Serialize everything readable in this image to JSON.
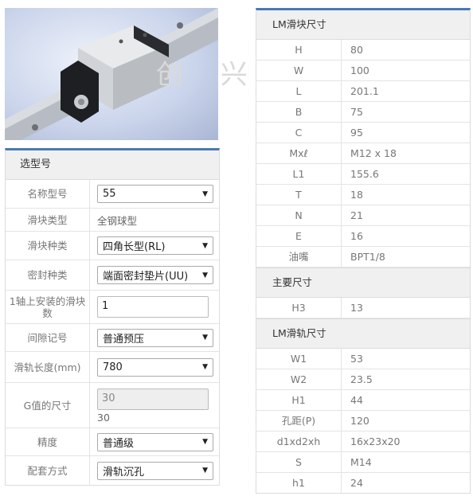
{
  "watermark": "创 兴 盛",
  "left_panel": {
    "title": "选型号",
    "rows": {
      "model_name": {
        "label": "名称型号",
        "value": "55"
      },
      "block_type": {
        "label": "滑块类型",
        "value": "全钢球型"
      },
      "block_kind": {
        "label": "滑块种类",
        "value": "四角长型(RL)"
      },
      "seal_kind": {
        "label": "密封种类",
        "value": "端面密封垫片(UU)"
      },
      "blocks_per_axis": {
        "label": "1轴上安装的滑块数",
        "value": "1"
      },
      "clearance": {
        "label": "间隙记号",
        "value": "普通预压"
      },
      "rail_length": {
        "label": "滑轨长度(mm)",
        "value": "780"
      },
      "g_value": {
        "label": "G值的尺寸",
        "input_value": "30",
        "text_value": "30"
      },
      "precision": {
        "label": "精度",
        "value": "普通级"
      },
      "fit_method": {
        "label": "配套方式",
        "value": "滑轨沉孔"
      }
    }
  },
  "right_panel": {
    "block_section": {
      "title": "LM滑块尺寸",
      "rows": [
        {
          "key": "H",
          "value": "80"
        },
        {
          "key": "W",
          "value": "100"
        },
        {
          "key": "L",
          "value": "201.1"
        },
        {
          "key": "B",
          "value": "75"
        },
        {
          "key": "C",
          "value": "95"
        },
        {
          "key": "Mxℓ",
          "value": "M12 x 18"
        },
        {
          "key": "L1",
          "value": "155.6"
        },
        {
          "key": "T",
          "value": "18"
        },
        {
          "key": "N",
          "value": "21"
        },
        {
          "key": "E",
          "value": "16"
        },
        {
          "key": "油嘴",
          "value": "BPT1/8"
        }
      ]
    },
    "main_section": {
      "title": "主要尺寸",
      "rows": [
        {
          "key": "H3",
          "value": "13"
        }
      ]
    },
    "rail_section": {
      "title": "LM滑轨尺寸",
      "rows": [
        {
          "key": "W1",
          "value": "53"
        },
        {
          "key": "W2",
          "value": "23.5"
        },
        {
          "key": "H1",
          "value": "44"
        },
        {
          "key": "孔距(P)",
          "value": "120"
        },
        {
          "key": "d1xd2xh",
          "value": "16x23x20"
        },
        {
          "key": "S",
          "value": "M14"
        },
        {
          "key": "h1",
          "value": "24"
        }
      ]
    }
  },
  "icons": {
    "dropdown": "▼"
  },
  "colors": {
    "accent": "#4a79b3",
    "header_bg": "#f0f0f0"
  }
}
